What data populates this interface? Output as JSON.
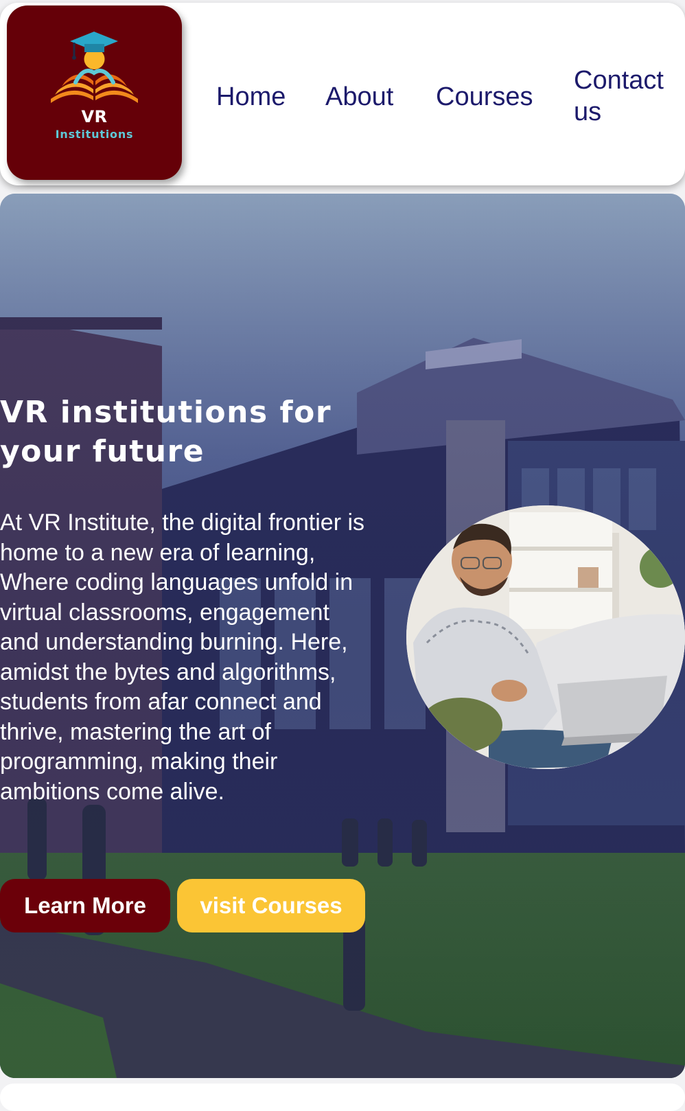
{
  "brand": {
    "name": "VR",
    "subtitle": "Institutions",
    "tile_color": "#650008",
    "emblem": "graduation-book-icon"
  },
  "nav": {
    "home": "Home",
    "about": "About",
    "courses": "Courses",
    "contact": "Contact us",
    "color": "#1c1a6b"
  },
  "hero": {
    "title": "VR institutions for your future",
    "text": "At VR Institute, the digital frontier is home to a new era of learning, Where coding languages unfold in virtual classrooms, engagement and understanding burning. Here, amidst the bytes and algorithms, students from afar connect and thrive, mastering the art of programming, making their ambitions come alive.",
    "learn_more": "Learn More",
    "visit_courses": "visit Courses",
    "learn_more_color": "#6b0009",
    "visit_courses_color": "#fbc535"
  }
}
